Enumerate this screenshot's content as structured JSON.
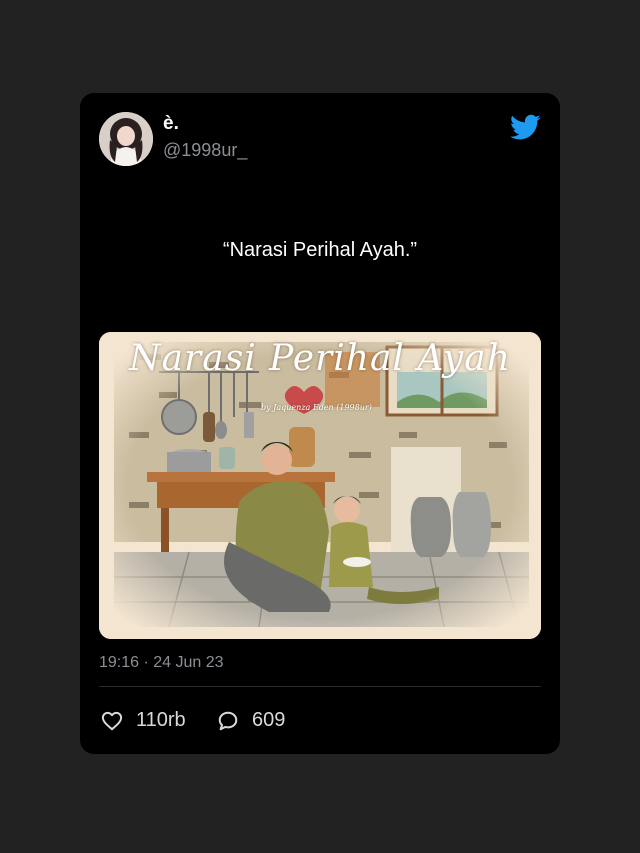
{
  "tweet": {
    "display_name": "è.",
    "handle": "@1998ur_",
    "text": "“Narasi Perihal Ayah.”",
    "timestamp": "19:16 · 24 Jun 23",
    "likes": "110rb",
    "replies": "609"
  },
  "media": {
    "title": "Narasi Perihal Ayah",
    "credit": "by Jaquenza Eden (1998ur)"
  },
  "icons": {
    "logo": "twitter-bird-icon",
    "like": "heart-icon",
    "reply": "speech-bubble-icon"
  },
  "colors": {
    "page_bg": "#222222",
    "card_bg": "#000000",
    "twitter_blue": "#1d9bf0",
    "secondary_text": "#8b8f94"
  }
}
